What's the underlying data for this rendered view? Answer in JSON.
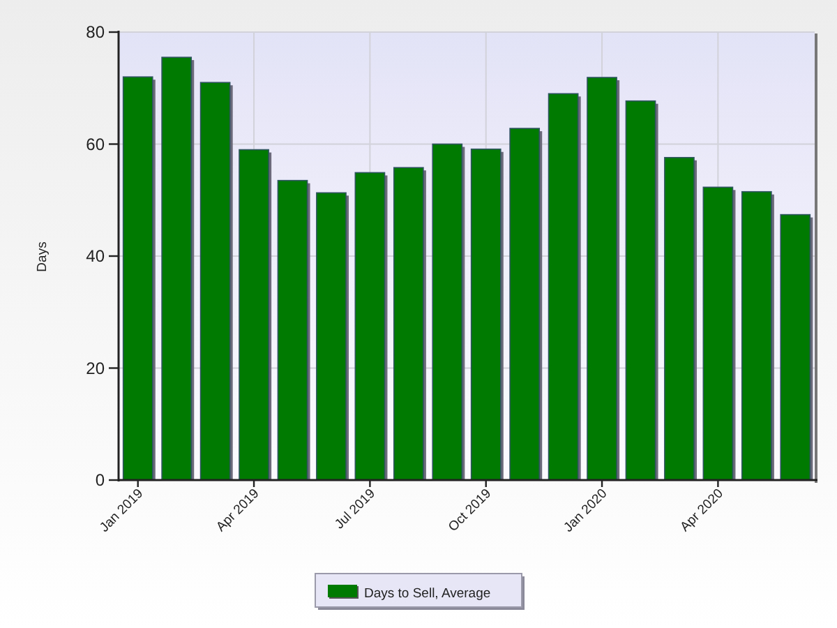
{
  "chart": {
    "chart_data": {
      "type": "bar",
      "ylabel": "Days",
      "categories": [
        "Jan 2019",
        null,
        null,
        "Apr 2019",
        null,
        null,
        "Jul 2019",
        null,
        null,
        "Oct 2019",
        null,
        null,
        "Jan 2020",
        null,
        null,
        "Apr 2020",
        null,
        null
      ],
      "series": [
        {
          "name": "Days to Sell, Average",
          "color": "#007a00",
          "values": [
            72,
            75.5,
            71,
            59,
            53.5,
            51.3,
            54.9,
            55.8,
            60,
            59.1,
            62.8,
            69,
            71.9,
            67.7,
            57.6,
            52.3,
            51.5,
            47.4
          ]
        }
      ],
      "grid": true,
      "ylim": [
        0,
        80
      ],
      "yticks": [
        0,
        20,
        40,
        60,
        80
      ]
    }
  }
}
